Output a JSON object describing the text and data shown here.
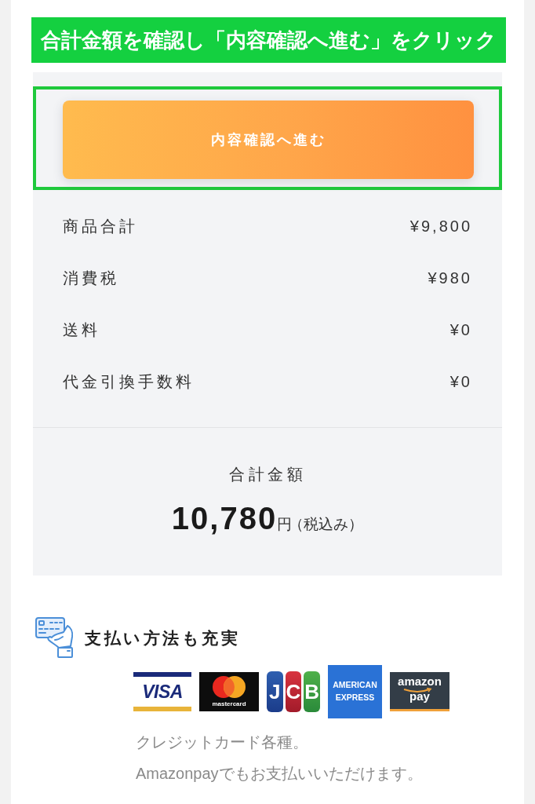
{
  "instruction_banner": {
    "text": "合計金額を確認し「内容確認へ進む」をクリック"
  },
  "summary": {
    "proceed_button": {
      "label": "内容確認へ進む",
      "highlighted": true
    },
    "rows": [
      {
        "label": "商品合計",
        "value": "¥9,800"
      },
      {
        "label": "消費税",
        "value": "¥980"
      },
      {
        "label": "送料",
        "value": "¥0"
      },
      {
        "label": "代金引換手数料",
        "value": "¥0"
      }
    ],
    "total": {
      "label": "合計金額",
      "amount": "10,780",
      "unit": "円",
      "note": "（税込み）"
    }
  },
  "payment": {
    "title": "支払い方法も充実",
    "methods": [
      {
        "kind": "visa",
        "label": "VISA"
      },
      {
        "kind": "mastercard",
        "label": "mastercard"
      },
      {
        "kind": "jcb",
        "label": "JCB"
      },
      {
        "kind": "amex",
        "label": "AMERICAN EXPRESS"
      },
      {
        "kind": "amazon_pay",
        "label": "amazon pay"
      }
    ],
    "notes": [
      "クレジットカード各種。",
      "Amazonpayでもお支払いいただけます。"
    ]
  }
}
